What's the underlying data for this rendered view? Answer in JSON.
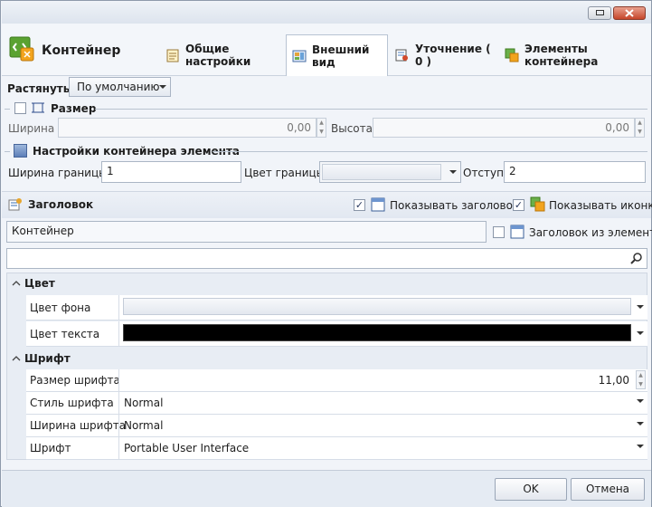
{
  "header": {
    "title": "Контейнер",
    "tabs": [
      {
        "label": "Общие настройки"
      },
      {
        "label": "Внешний вид"
      },
      {
        "label": "Уточнение ( 0 )"
      },
      {
        "label": "Элементы контейнера"
      }
    ]
  },
  "stretch": {
    "label": "Растянуть :",
    "value": "По умолчанию"
  },
  "size": {
    "label": "Размер",
    "width_label": "Ширина :",
    "width_value": "0,00",
    "height_label": "Высота :",
    "height_value": "0,00"
  },
  "container": {
    "label": "Настройки контейнера элемента",
    "border_width_label": "Ширина границы :",
    "border_width_value": "1",
    "border_color_label": "Цвет границы :",
    "border_color_value": "",
    "padding_label": "Отступ :",
    "padding_value": "2"
  },
  "caption": {
    "label": "Заголовок",
    "show_caption_label": "Показывать заголовок",
    "show_icon_label": "Показывать иконку",
    "text_value": "Контейнер",
    "from_element_label": "Заголовок из элемента",
    "search_placeholder": ""
  },
  "properties": {
    "color_section": "Цвет",
    "bg_color_label": "Цвет фона",
    "text_color_label": "Цвет текста",
    "text_color_hex": "#000000",
    "font_section": "Шрифт",
    "font_size_label": "Размер шрифта",
    "font_size_value": "11,00",
    "font_style_label": "Стиль шрифта",
    "font_style_value": "Normal",
    "font_width_label": "Ширина шрифта",
    "font_width_value": "Normal",
    "font_label": "Шрифт",
    "font_value": "Portable User Interface"
  },
  "buttons": {
    "ok": "OK",
    "cancel": "Отмена"
  }
}
